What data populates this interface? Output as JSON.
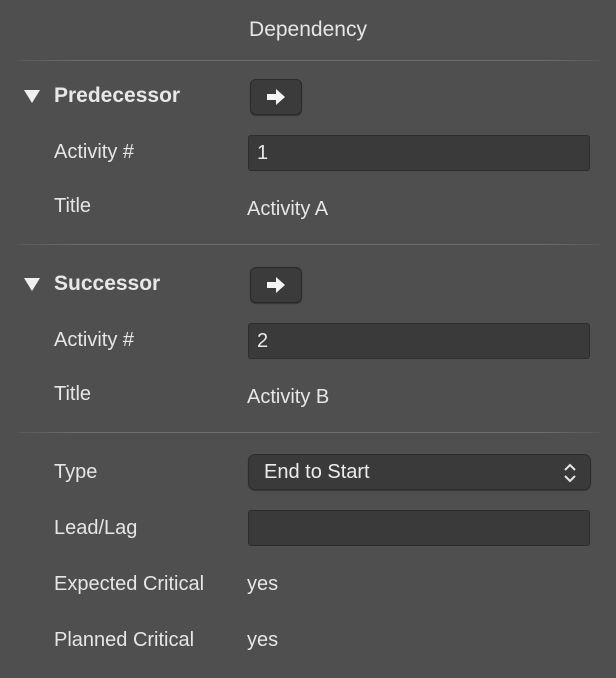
{
  "header": {
    "title": "Dependency"
  },
  "predecessor": {
    "heading": "Predecessor",
    "go_button_icon": "right-arrow-icon",
    "activity_label": "Activity #",
    "activity_value": "1",
    "title_label": "Title",
    "title_value": "Activity A"
  },
  "successor": {
    "heading": "Successor",
    "go_button_icon": "right-arrow-icon",
    "activity_label": "Activity #",
    "activity_value": "2",
    "title_label": "Title",
    "title_value": "Activity B"
  },
  "details": {
    "type_label": "Type",
    "type_value": "End to Start",
    "lead_lag_label": "Lead/Lag",
    "lead_lag_value": "",
    "expected_critical_label": "Expected Critical",
    "expected_critical_value": "yes",
    "planned_critical_label": "Planned Critical",
    "planned_critical_value": "yes"
  }
}
